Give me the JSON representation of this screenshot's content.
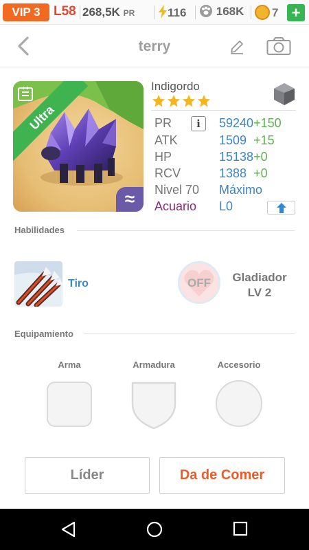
{
  "status_bar": {
    "vip": "VIP 3",
    "level": "L58",
    "power": "268,5K",
    "power_unit": "PR",
    "energy": "116",
    "food": "168K",
    "coins": "7",
    "add_label": "+"
  },
  "nav": {
    "title": "terry"
  },
  "creature": {
    "rarity": "Ultra",
    "element_symbol": "≈",
    "name": "Indigordo",
    "stars": 4,
    "stats": {
      "pr_label": "PR",
      "pr_info": "i",
      "pr_value": "59240",
      "pr_bonus": "+150",
      "atk_label": "ATK",
      "atk_value": "1509",
      "atk_bonus": "+15",
      "hp_label": "HP",
      "hp_value": "15138",
      "hp_bonus": "+0",
      "rcv_label": "RCV",
      "rcv_value": "1388",
      "rcv_bonus": "+0",
      "level_label": "Nivel 70",
      "level_value": "Máximo",
      "class_label": "Acuario",
      "class_value": "L0"
    }
  },
  "skills": {
    "section_title": "Habilidades",
    "active_skill": "Tiro",
    "leader_state": "OFF",
    "leader_name": "Gladiador",
    "leader_level": "LV 2"
  },
  "equipment": {
    "section_title": "Equipamiento",
    "weapon_label": "Arma",
    "armor_label": "Armadura",
    "accessory_label": "Accesorio"
  },
  "actions": {
    "leader_label": "Líder",
    "feed_label": "Da de Comer"
  },
  "colors": {
    "accent_orange": "#ee5a28",
    "stat_blue": "#3d86c6",
    "bonus_green": "#59b34a",
    "ultra_green": "#3fb34f",
    "star_gold": "#f5b51c"
  }
}
